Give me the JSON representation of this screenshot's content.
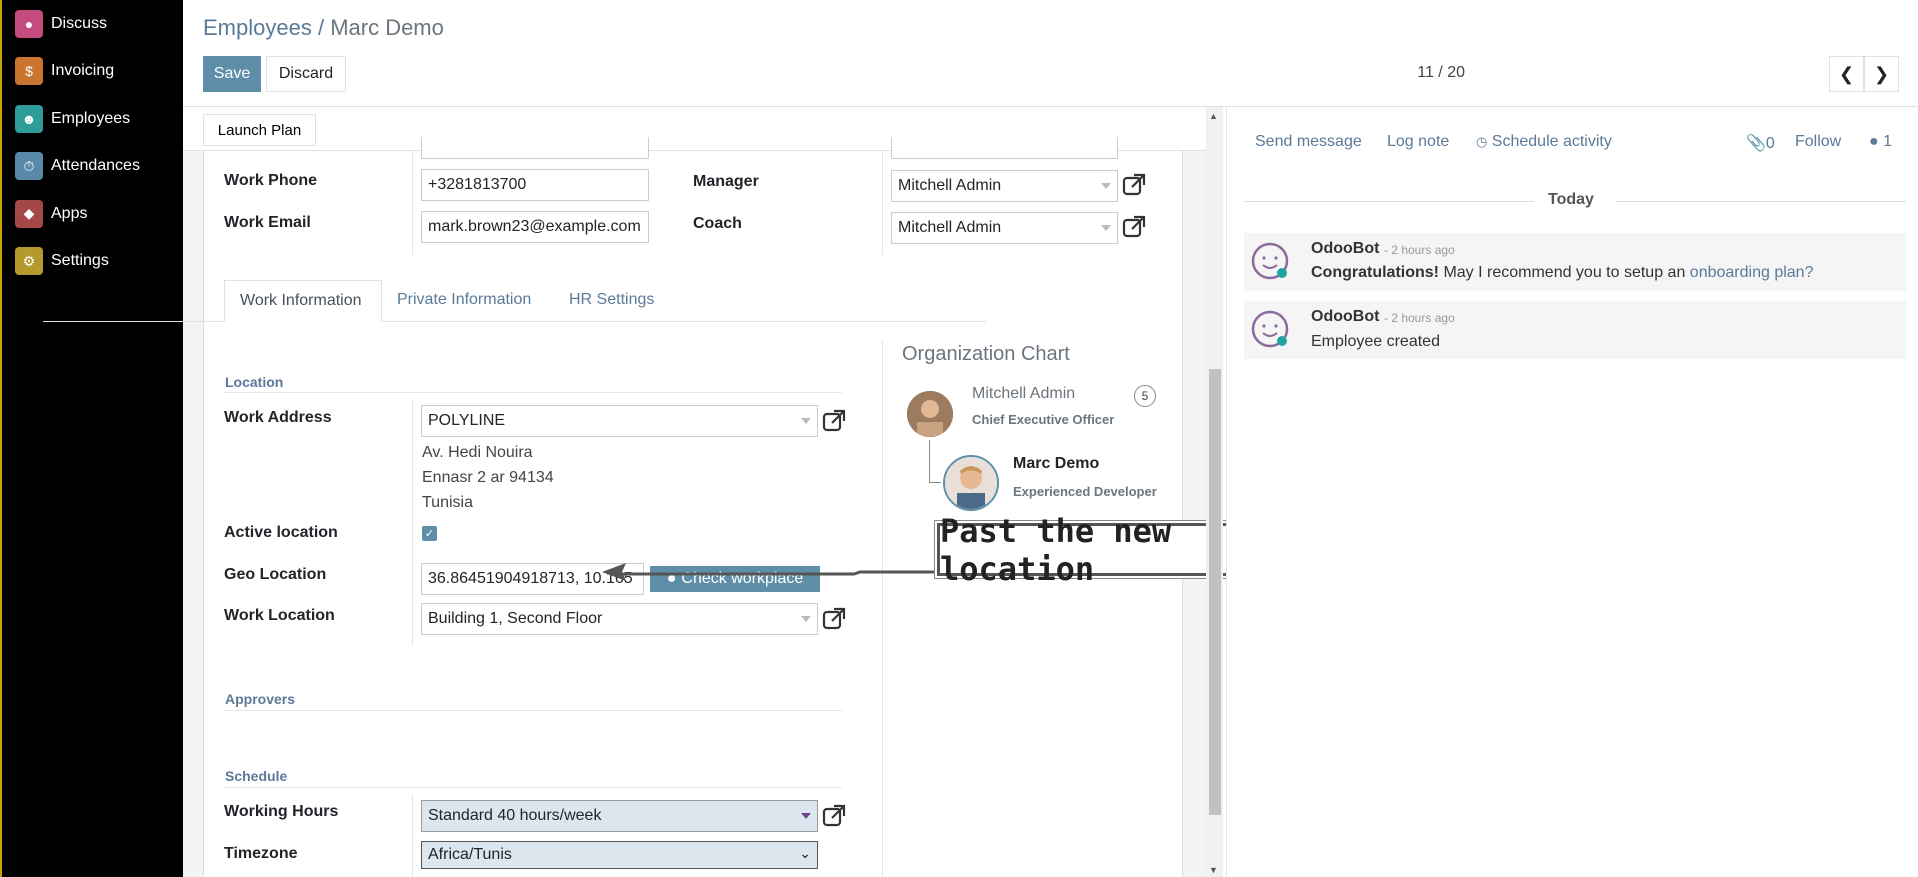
{
  "sidebar": {
    "items": [
      {
        "label": "Discuss",
        "icon": "chat-icon",
        "color": "#c44b7d"
      },
      {
        "label": "Invoicing",
        "icon": "invoice-icon",
        "color": "#c9752f"
      },
      {
        "label": "Employees",
        "icon": "people-icon",
        "color": "#2e9c98"
      },
      {
        "label": "Attendances",
        "icon": "attendance-icon",
        "color": "#5889a8"
      },
      {
        "label": "Apps",
        "icon": "apps-icon",
        "color": "#a34747"
      },
      {
        "label": "Settings",
        "icon": "gear-icon",
        "color": "#b49a2c"
      }
    ]
  },
  "header": {
    "breadcrumb_parent": "Employees",
    "breadcrumb_sep": " / ",
    "breadcrumb_current": "Marc Demo",
    "save_label": "Save",
    "discard_label": "Discard",
    "pager": "11 / 20"
  },
  "statusbar": {
    "launch_plan_label": "Launch Plan"
  },
  "form": {
    "work_phone_label": "Work Phone",
    "work_phone_value": "+3281813700",
    "work_email_label": "Work Email",
    "work_email_value": "mark.brown23@example.com",
    "manager_label": "Manager",
    "manager_value": "Mitchell Admin",
    "coach_label": "Coach",
    "coach_value": "Mitchell Admin"
  },
  "tabs": [
    {
      "label": "Work Information",
      "active": true
    },
    {
      "label": "Private Information",
      "active": false
    },
    {
      "label": "HR Settings",
      "active": false
    }
  ],
  "work_info": {
    "location_section": "Location",
    "work_address_label": "Work Address",
    "work_address_value": "POLYLINE",
    "address_lines": [
      "Av. Hedi Nouira",
      "Ennasr 2 ar 94134",
      "Tunisia"
    ],
    "active_location_label": "Active location",
    "active_location_checked": true,
    "geo_location_label": "Geo Location",
    "geo_location_value": "36.86451904918713, 10.165",
    "check_workplace_label": "Check workplace",
    "work_location_label": "Work Location",
    "work_location_value": "Building 1, Second Floor",
    "approvers_section": "Approvers",
    "schedule_section": "Schedule",
    "working_hours_label": "Working Hours",
    "working_hours_value": "Standard 40 hours/week",
    "timezone_label": "Timezone",
    "timezone_value": "Africa/Tunis"
  },
  "org_chart": {
    "title": "Organization Chart",
    "manager_name": "Mitchell Admin",
    "manager_role": "Chief Executive Officer",
    "manager_count": "5",
    "employee_name": "Marc Demo",
    "employee_role": "Experienced Developer"
  },
  "callout": {
    "text": "Past the new location"
  },
  "chatter": {
    "send_message": "Send message",
    "log_note": "Log note",
    "schedule_activity": "Schedule activity",
    "attachments_count": "0",
    "follow": "Follow",
    "followers_count": "1",
    "today": "Today",
    "messages": [
      {
        "author": "OdooBot",
        "time": "- 2 hours ago",
        "bold": "Congratulations!",
        "text": " May I recommend you to setup an ",
        "link": "onboarding plan?"
      },
      {
        "author": "OdooBot",
        "time": "- 2 hours ago",
        "text": "Employee created"
      }
    ]
  },
  "colors": {
    "primary": "#5f8fa8",
    "link": "#5b7a99",
    "sidebar_bg": "#000000"
  }
}
